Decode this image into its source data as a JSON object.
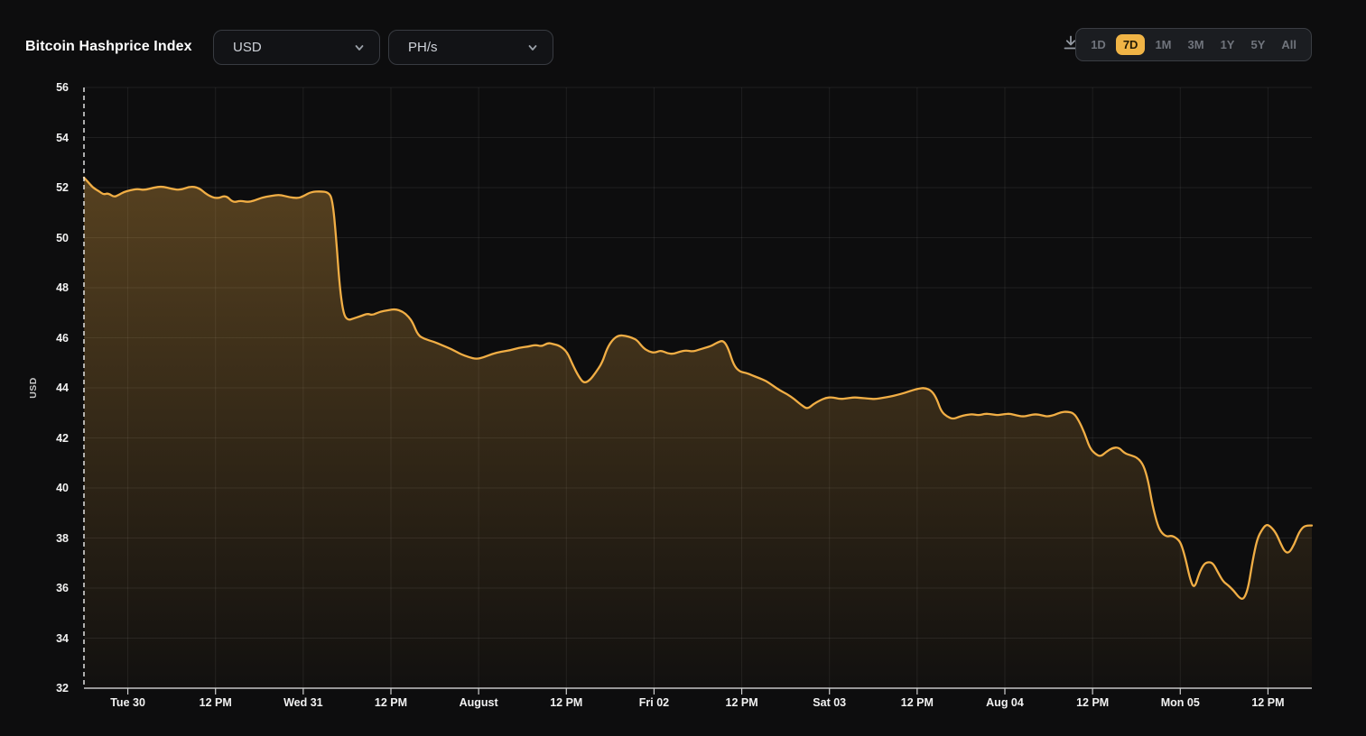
{
  "header": {
    "title": "Bitcoin Hashprice Index",
    "currency_dropdown": {
      "value": "USD"
    },
    "unit_dropdown": {
      "value": "PH/s"
    },
    "range_selector": {
      "options": [
        "1D",
        "7D",
        "1M",
        "3M",
        "1Y",
        "5Y",
        "All"
      ],
      "selected": "7D"
    }
  },
  "colors": {
    "background": "#0D0D0E",
    "accent": "#F0B446",
    "line": "#F1AE45",
    "panel": "#121316",
    "panel_border": "#383B41",
    "muted_text": "#70747C",
    "axis_text": "#F2F2F2"
  },
  "chart_data": {
    "type": "area",
    "title": "Bitcoin Hashprice Index",
    "ylabel": "USD",
    "ylim": [
      32,
      56
    ],
    "xlim": [
      0,
      168
    ],
    "grid": true,
    "y_ticks": [
      56,
      54,
      52,
      50,
      48,
      46,
      44,
      42,
      40,
      38,
      36,
      34,
      32
    ],
    "x_ticks": [
      {
        "label": "Tue 30",
        "hour": 6
      },
      {
        "label": "12 PM",
        "hour": 18
      },
      {
        "label": "Wed 31",
        "hour": 30
      },
      {
        "label": "12 PM",
        "hour": 42
      },
      {
        "label": "August",
        "hour": 54
      },
      {
        "label": "12 PM",
        "hour": 66
      },
      {
        "label": "Fri 02",
        "hour": 78
      },
      {
        "label": "12 PM",
        "hour": 90
      },
      {
        "label": "Sat 03",
        "hour": 102
      },
      {
        "label": "12 PM",
        "hour": 114
      },
      {
        "label": "Aug 04",
        "hour": 126
      },
      {
        "label": "12 PM",
        "hour": 138
      },
      {
        "label": "Mon 05",
        "hour": 150
      },
      {
        "label": "12 PM",
        "hour": 162
      }
    ],
    "points": [
      [
        0,
        52.4
      ],
      [
        0.5,
        52.25
      ],
      [
        1.2,
        52.0
      ],
      [
        2.1,
        51.85
      ],
      [
        2.7,
        51.72
      ],
      [
        3.3,
        51.78
      ],
      [
        4.1,
        51.62
      ],
      [
        4.7,
        51.7
      ],
      [
        5.4,
        51.82
      ],
      [
        6.4,
        51.9
      ],
      [
        7.3,
        51.95
      ],
      [
        8.3,
        51.9
      ],
      [
        9.5,
        52.0
      ],
      [
        10.7,
        52.05
      ],
      [
        12.0,
        51.95
      ],
      [
        13.2,
        51.9
      ],
      [
        14.5,
        52.05
      ],
      [
        15.7,
        52.0
      ],
      [
        16.9,
        51.7
      ],
      [
        18.2,
        51.55
      ],
      [
        19.4,
        51.7
      ],
      [
        20.4,
        51.4
      ],
      [
        21.4,
        51.48
      ],
      [
        22.4,
        51.42
      ],
      [
        23.3,
        51.48
      ],
      [
        24.3,
        51.6
      ],
      [
        25.6,
        51.67
      ],
      [
        26.8,
        51.72
      ],
      [
        28.0,
        51.62
      ],
      [
        29.3,
        51.57
      ],
      [
        30.1,
        51.67
      ],
      [
        31.1,
        51.83
      ],
      [
        32.4,
        51.85
      ],
      [
        33.4,
        51.82
      ],
      [
        34.0,
        51.55
      ],
      [
        34.5,
        50.0
      ],
      [
        35.0,
        48.0
      ],
      [
        35.5,
        46.95
      ],
      [
        36.1,
        46.7
      ],
      [
        36.9,
        46.77
      ],
      [
        37.9,
        46.87
      ],
      [
        38.8,
        46.97
      ],
      [
        39.5,
        46.9
      ],
      [
        40.5,
        47.05
      ],
      [
        41.6,
        47.1
      ],
      [
        42.6,
        47.15
      ],
      [
        43.6,
        47.05
      ],
      [
        44.4,
        46.85
      ],
      [
        45.0,
        46.6
      ],
      [
        45.7,
        46.1
      ],
      [
        46.6,
        45.95
      ],
      [
        47.8,
        45.85
      ],
      [
        49.0,
        45.7
      ],
      [
        50.3,
        45.55
      ],
      [
        51.5,
        45.35
      ],
      [
        52.7,
        45.22
      ],
      [
        53.7,
        45.15
      ],
      [
        54.7,
        45.22
      ],
      [
        55.8,
        45.35
      ],
      [
        57.1,
        45.45
      ],
      [
        58.3,
        45.5
      ],
      [
        59.5,
        45.6
      ],
      [
        60.8,
        45.65
      ],
      [
        61.8,
        45.72
      ],
      [
        62.6,
        45.65
      ],
      [
        63.5,
        45.8
      ],
      [
        64.2,
        45.75
      ],
      [
        65.1,
        45.68
      ],
      [
        66.1,
        45.45
      ],
      [
        66.9,
        44.9
      ],
      [
        67.7,
        44.45
      ],
      [
        68.4,
        44.18
      ],
      [
        69.2,
        44.3
      ],
      [
        70.0,
        44.6
      ],
      [
        70.9,
        45.0
      ],
      [
        71.6,
        45.6
      ],
      [
        72.4,
        45.95
      ],
      [
        73.2,
        46.1
      ],
      [
        74.1,
        46.08
      ],
      [
        75.0,
        46.0
      ],
      [
        75.7,
        45.9
      ],
      [
        76.5,
        45.6
      ],
      [
        77.3,
        45.45
      ],
      [
        78.1,
        45.4
      ],
      [
        78.9,
        45.5
      ],
      [
        79.8,
        45.38
      ],
      [
        80.7,
        45.35
      ],
      [
        81.5,
        45.45
      ],
      [
        82.4,
        45.5
      ],
      [
        83.3,
        45.45
      ],
      [
        84.1,
        45.52
      ],
      [
        85.0,
        45.6
      ],
      [
        85.9,
        45.68
      ],
      [
        86.7,
        45.82
      ],
      [
        87.5,
        45.9
      ],
      [
        88.2,
        45.55
      ],
      [
        88.9,
        44.9
      ],
      [
        89.7,
        44.65
      ],
      [
        90.6,
        44.6
      ],
      [
        91.4,
        44.5
      ],
      [
        92.3,
        44.4
      ],
      [
        93.3,
        44.28
      ],
      [
        94.2,
        44.1
      ],
      [
        95.2,
        43.9
      ],
      [
        96.2,
        43.75
      ],
      [
        97.2,
        43.55
      ],
      [
        98.2,
        43.3
      ],
      [
        99.0,
        43.15
      ],
      [
        99.8,
        43.35
      ],
      [
        100.7,
        43.5
      ],
      [
        101.5,
        43.6
      ],
      [
        102.4,
        43.63
      ],
      [
        103.4,
        43.55
      ],
      [
        104.4,
        43.58
      ],
      [
        105.3,
        43.62
      ],
      [
        106.3,
        43.6
      ],
      [
        107.3,
        43.57
      ],
      [
        108.3,
        43.55
      ],
      [
        109.3,
        43.6
      ],
      [
        110.3,
        43.65
      ],
      [
        111.3,
        43.72
      ],
      [
        112.3,
        43.8
      ],
      [
        113.3,
        43.9
      ],
      [
        114.2,
        43.97
      ],
      [
        115.1,
        44.0
      ],
      [
        116.0,
        43.88
      ],
      [
        116.7,
        43.55
      ],
      [
        117.3,
        43.05
      ],
      [
        118.1,
        42.85
      ],
      [
        118.9,
        42.75
      ],
      [
        119.8,
        42.85
      ],
      [
        120.7,
        42.92
      ],
      [
        121.5,
        42.95
      ],
      [
        122.4,
        42.9
      ],
      [
        123.3,
        42.97
      ],
      [
        124.1,
        42.95
      ],
      [
        125.0,
        42.9
      ],
      [
        125.9,
        42.95
      ],
      [
        126.7,
        42.97
      ],
      [
        127.6,
        42.9
      ],
      [
        128.5,
        42.85
      ],
      [
        129.3,
        42.9
      ],
      [
        130.2,
        42.95
      ],
      [
        131.1,
        42.9
      ],
      [
        131.9,
        42.85
      ],
      [
        132.8,
        42.92
      ],
      [
        133.7,
        43.03
      ],
      [
        134.5,
        43.05
      ],
      [
        135.4,
        43.0
      ],
      [
        136.1,
        42.7
      ],
      [
        136.9,
        42.2
      ],
      [
        137.6,
        41.6
      ],
      [
        138.4,
        41.35
      ],
      [
        139.1,
        41.25
      ],
      [
        139.9,
        41.45
      ],
      [
        140.7,
        41.6
      ],
      [
        141.6,
        41.62
      ],
      [
        142.4,
        41.38
      ],
      [
        143.3,
        41.3
      ],
      [
        144.2,
        41.2
      ],
      [
        145.0,
        40.9
      ],
      [
        145.6,
        40.3
      ],
      [
        146.2,
        39.3
      ],
      [
        146.9,
        38.5
      ],
      [
        147.5,
        38.18
      ],
      [
        148.2,
        38.05
      ],
      [
        148.8,
        38.1
      ],
      [
        149.5,
        38.0
      ],
      [
        150.1,
        37.8
      ],
      [
        150.7,
        37.2
      ],
      [
        151.3,
        36.4
      ],
      [
        151.9,
        35.95
      ],
      [
        152.6,
        36.6
      ],
      [
        153.2,
        36.95
      ],
      [
        153.8,
        37.05
      ],
      [
        154.5,
        37.0
      ],
      [
        155.2,
        36.6
      ],
      [
        155.9,
        36.25
      ],
      [
        156.6,
        36.1
      ],
      [
        157.3,
        35.9
      ],
      [
        158.1,
        35.6
      ],
      [
        158.7,
        35.55
      ],
      [
        159.3,
        36.0
      ],
      [
        159.9,
        37.1
      ],
      [
        160.5,
        37.95
      ],
      [
        161.2,
        38.35
      ],
      [
        161.8,
        38.55
      ],
      [
        162.4,
        38.45
      ],
      [
        163.1,
        38.2
      ],
      [
        163.7,
        37.8
      ],
      [
        164.3,
        37.45
      ],
      [
        164.9,
        37.4
      ],
      [
        165.6,
        37.75
      ],
      [
        166.2,
        38.2
      ],
      [
        166.8,
        38.45
      ],
      [
        167.4,
        38.5
      ],
      [
        168,
        38.5
      ]
    ]
  }
}
